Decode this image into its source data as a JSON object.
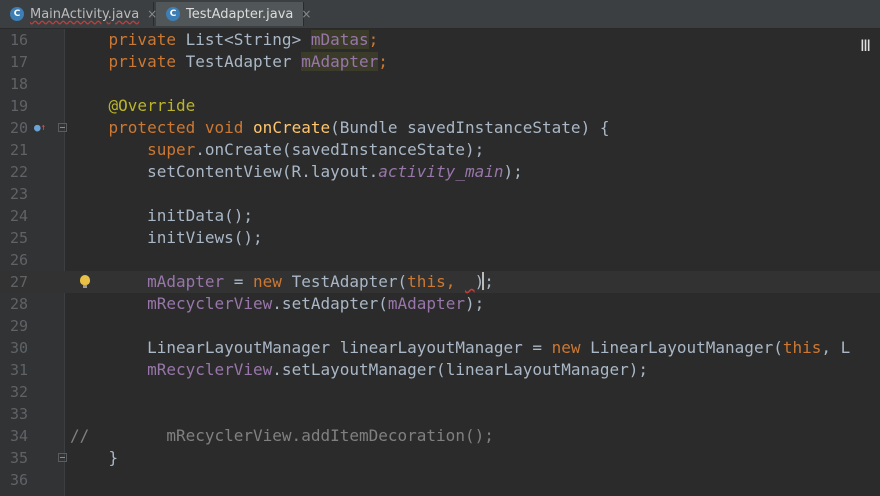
{
  "tabs": [
    {
      "label": "MainActivity.java",
      "icon": "C",
      "close": "×"
    },
    {
      "label": "TestAdapter.java",
      "icon": "C",
      "close": "×"
    }
  ],
  "lines": [
    {
      "num": "16",
      "p": [
        "    ",
        "private",
        " List<String> ",
        "mDatas",
        ";"
      ]
    },
    {
      "num": "17",
      "p": [
        "    ",
        "private",
        " TestAdapter ",
        "mAdapter",
        ";"
      ]
    },
    {
      "num": "18",
      "p": []
    },
    {
      "num": "19",
      "p": [
        "    ",
        "@Override"
      ]
    },
    {
      "num": "20",
      "p": [
        "    ",
        "protected",
        " ",
        "void",
        " ",
        "onCreate",
        "(Bundle savedInstanceState) {"
      ]
    },
    {
      "num": "21",
      "p": [
        "        ",
        "super",
        ".onCreate(savedInstanceState);"
      ]
    },
    {
      "num": "22",
      "p": [
        "        setContentView(R.layout.",
        "activity_main",
        ");"
      ]
    },
    {
      "num": "23",
      "p": []
    },
    {
      "num": "24",
      "p": [
        "        initData();"
      ]
    },
    {
      "num": "25",
      "p": [
        "        initViews();"
      ]
    },
    {
      "num": "26",
      "p": []
    },
    {
      "num": "27",
      "p": [
        "        ",
        "mAdapter",
        " = ",
        "new",
        " TestAdapter(",
        "this",
        ", ",
        " ",
        ");"
      ]
    },
    {
      "num": "28",
      "p": [
        "        ",
        "mRecyclerView",
        ".setAdapter(",
        "mAdapter",
        ");"
      ]
    },
    {
      "num": "29",
      "p": []
    },
    {
      "num": "30",
      "p": [
        "        LinearLayoutManager linearLayoutManager = ",
        "new",
        " LinearLayoutManager(",
        "this",
        ", L"
      ]
    },
    {
      "num": "31",
      "p": [
        "        ",
        "mRecyclerView",
        ".setLayoutManager(linearLayoutManager);"
      ]
    },
    {
      "num": "32",
      "p": []
    },
    {
      "num": "33",
      "p": []
    },
    {
      "num": "34",
      "p": [
        "//        mRecyclerView.addItemDecoration();"
      ]
    },
    {
      "num": "35",
      "p": [
        "    }"
      ]
    },
    {
      "num": "36",
      "p": []
    }
  ],
  "colors": {
    "background": "#2b2b2b",
    "keyword": "#cc7832",
    "annotation": "#bbb529",
    "field": "#9876aa",
    "method": "#ffc66d",
    "comment": "#808080",
    "text": "#a9b7c6"
  }
}
